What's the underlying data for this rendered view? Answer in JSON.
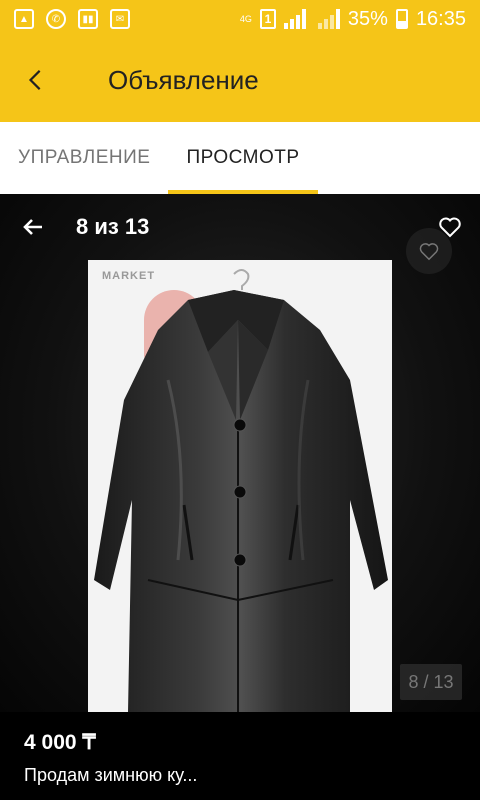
{
  "status_bar": {
    "network": "4G",
    "sim": "1",
    "battery": "35%",
    "time": "16:35"
  },
  "app_bar": {
    "title": "Объявление"
  },
  "tabs": [
    {
      "label": "УПРАВЛЕНИЕ",
      "active": false
    },
    {
      "label": "ПРОСМОТР",
      "active": true
    }
  ],
  "gallery": {
    "counter": "8 из 13",
    "page_badge": "8 / 13",
    "watermark": "MARKET"
  },
  "listing": {
    "price": "4 000 ₸",
    "title": "Продам зимнюю ку..."
  },
  "colors": {
    "accent": "#f5c518",
    "background": "#000000"
  }
}
